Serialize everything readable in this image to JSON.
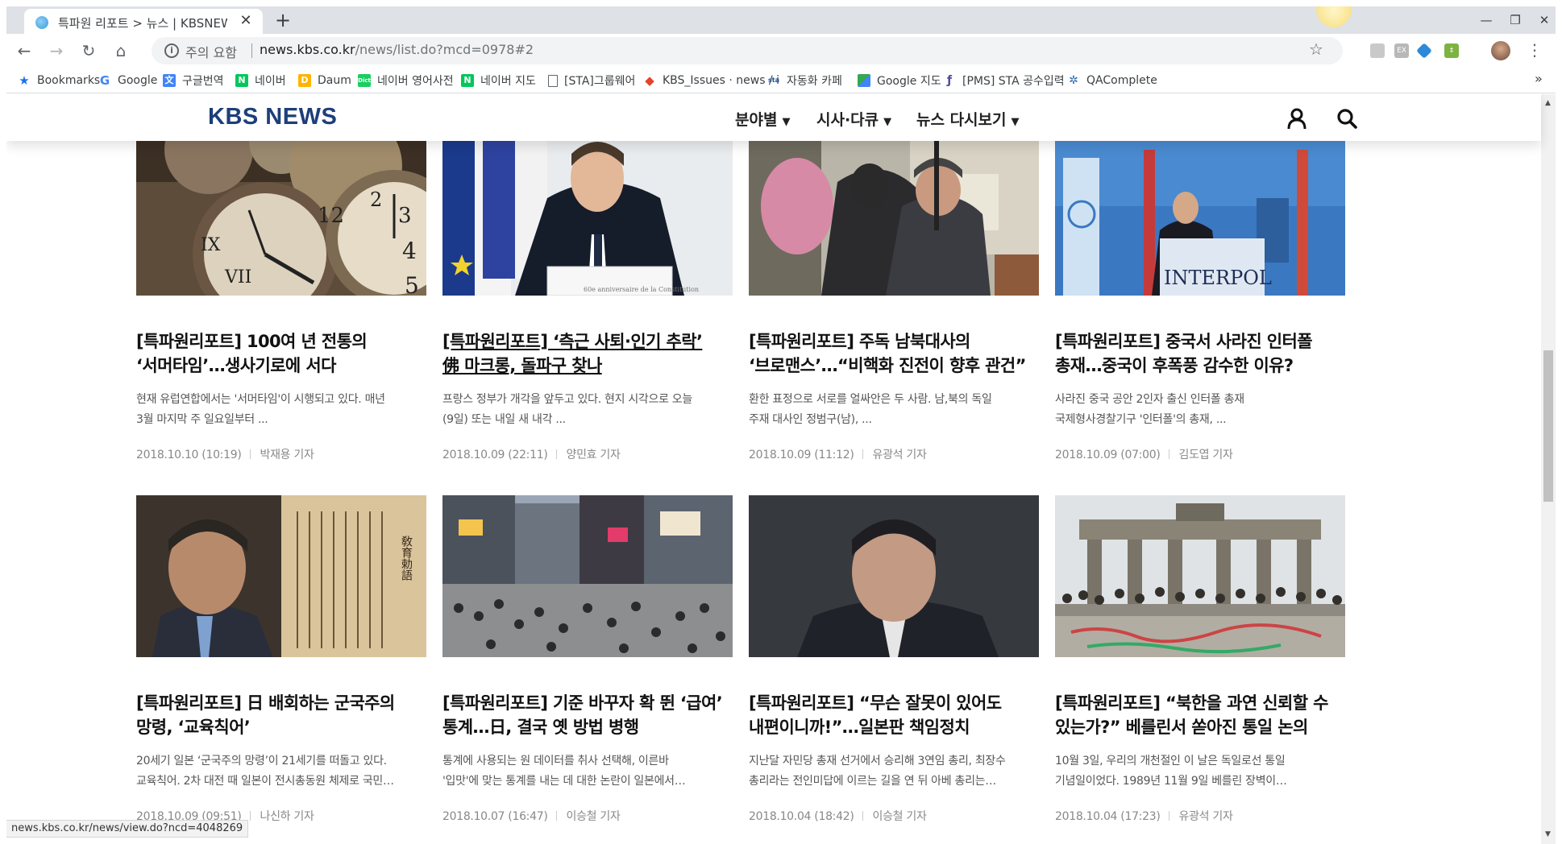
{
  "browser": {
    "tab_title": "특파원 리포트 > 뉴스 | KBSNEWS",
    "tab_close": "✕",
    "new_tab": "+",
    "window_controls": {
      "minimize": "—",
      "restore": "❐",
      "close": "✕"
    },
    "security_warning": "주의 요함",
    "url_host": "news.kbs.co.kr",
    "url_path": "/news/list.do?mcd=0978#2",
    "status_url": "news.kbs.co.kr/news/view.do?ncd=4048269"
  },
  "bookmarks": [
    {
      "label": "Bookmarks",
      "icon": "star-icon",
      "color": "#1a73e8"
    },
    {
      "label": "Google",
      "icon": "google-icon",
      "color": "#4285f4"
    },
    {
      "label": "구글번역",
      "icon": "translate-icon",
      "color": "#4285f4"
    },
    {
      "label": "네이버",
      "icon": "naver-icon",
      "color": "#03c75a"
    },
    {
      "label": "Daum",
      "icon": "daum-icon",
      "color": "#ffb400"
    },
    {
      "label": "네이버 영어사전",
      "icon": "dict-icon",
      "color": "#19ce60"
    },
    {
      "label": "네이버 지도",
      "icon": "naver-icon",
      "color": "#03c75a"
    },
    {
      "label": "[STA]그룹웨어",
      "icon": "page-icon",
      "color": "#5f6368"
    },
    {
      "label": "KBS_Issues · news / i",
      "icon": "gitlab-icon",
      "color": "#e24329"
    },
    {
      "label": "자동화 카페",
      "icon": "sta-icon",
      "color": "#1a4fa0"
    },
    {
      "label": "Google 지도",
      "icon": "maps-icon",
      "color": "#34a853"
    },
    {
      "label": "[PMS] STA 공수입력",
      "icon": "pms-icon",
      "color": "#4a4a9a"
    },
    {
      "label": "QAComplete",
      "icon": "qa-icon",
      "color": "#2a6ab0"
    }
  ],
  "bookmarks_more": "»",
  "site": {
    "logo": "KBS NEWS",
    "nav": [
      {
        "label": "분야별"
      },
      {
        "label": "시사·다큐"
      },
      {
        "label": "뉴스 다시보기"
      }
    ],
    "caret": "▼"
  },
  "articles": [
    {
      "title_line1": "[특파원리포트] 100여 년 전통의",
      "title_line2": "‘서머타임’…생사기로에 서다",
      "desc_line1": "현재 유럽연합에서는 '서머타임'이 시행되고 있다. 매년",
      "desc_line2": "3월 마지막 주 일요일부터 ...",
      "date": "2018.10.10 (10:19)",
      "reporter": "박재용 기자",
      "image": "clocks"
    },
    {
      "title_line1": "[특파원리포트] ‘측근 사퇴·인기 추락’",
      "title_line2": "佛 마크롱, 돌파구 찾나",
      "desc_line1": "프랑스 정부가 개각을 앞두고 있다. 현지 시각으로 오늘",
      "desc_line2": "(9일) 또는 내일 새 내각 ...",
      "date": "2018.10.09 (22:11)",
      "reporter": "양민효 기자",
      "image": "macron",
      "caption_on_image": "60e anniversaire de la Constitution"
    },
    {
      "title_line1": "[특파원리포트] 주독 남북대사의",
      "title_line2": "‘브로맨스’…“비핵화 진전이 향후 관건”",
      "desc_line1": "환한 표정으로 서로를 얼싸안은 두 사람. 남,북의 독일",
      "desc_line2": "주재 대사인 정범구(남), ...",
      "date": "2018.10.09 (11:12)",
      "reporter": "유광석 기자",
      "image": "embrace"
    },
    {
      "title_line1": "[특파원리포트] 중국서 사라진 인터폴",
      "title_line2": "총재…중국이 후폭풍 감수한 이유?",
      "desc_line1": "사라진 중국 공안 2인자 출신 인터폴 총재",
      "desc_line2": "국제형사경찰기구 '인터폴'의 총재, ...",
      "date": "2018.10.09 (07:00)",
      "reporter": "김도엽 기자",
      "image": "interpol",
      "caption_on_image": "INTERPOL"
    },
    {
      "title_line1": "[특파원리포트] 日 배회하는 군국주의",
      "title_line2": "망령, ‘교육칙어’",
      "desc_line1": "20세기 일본 ‘군국주의 망령’이 21세기를 떠돌고 있다.",
      "desc_line2": "교육칙어. 2차 대전 때 일본이 전시총동원 체제로 국민…",
      "date": "2018.10.09 (09:51)",
      "reporter": "나신하 기자",
      "image": "rescript",
      "caption_on_image": "敎育勅語"
    },
    {
      "title_line1": "[특파원리포트] 기준 바꾸자 확 뛴 ‘급여’",
      "title_line2": "통계…日, 결국 옛 방법 병행",
      "desc_line1": "통계에 사용되는 원 데이터를 취사 선택해, 이른바",
      "desc_line2": "'입맛'에 맞는 통계를 내는 데 대한 논란이 일본에서…",
      "date": "2018.10.07 (16:47)",
      "reporter": "이승철 기자",
      "image": "crossing"
    },
    {
      "title_line1": "[특파원리포트] “무슨 잘못이 있어도",
      "title_line2": "내편이니까!”…일본판 책임정치",
      "desc_line1": "지난달 자민당 총재 선거에서 승리해 3연임 총리, 최장수",
      "desc_line2": "총리라는 전인미답에 이르는 길을 연 뒤 아베 총리는…",
      "date": "2018.10.04 (18:42)",
      "reporter": "이승철 기자",
      "image": "abe"
    },
    {
      "title_line1": "[특파원리포트] “북한을 과연 신뢰할 수",
      "title_line2": "있는가?” 베를린서 쏟아진 통일 논의",
      "desc_line1": "10월 3일, 우리의 개천절인 이 날은 독일로선 통일",
      "desc_line2": "기념일이었다. 1989년 11월 9일 베를린 장벽이…",
      "date": "2018.10.04 (17:23)",
      "reporter": "유광석 기자",
      "image": "berlin"
    }
  ]
}
